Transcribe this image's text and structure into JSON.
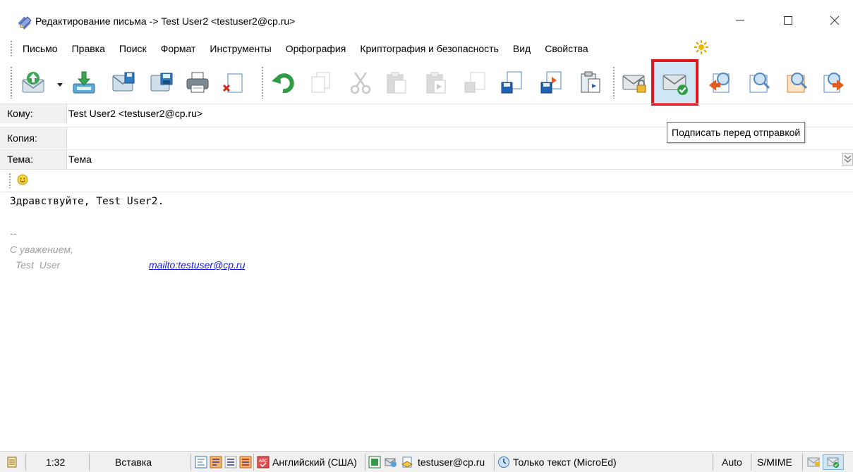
{
  "window": {
    "title": "Редактирование письма -> Test User2 <testuser2@cp.ru>",
    "icon": "edit-pencil-icon"
  },
  "menu": {
    "items": [
      {
        "label": "Письмо"
      },
      {
        "label": "Правка"
      },
      {
        "label": "Поиск"
      },
      {
        "label": "Формат"
      },
      {
        "label": "Инструменты"
      },
      {
        "label": "Орфография"
      },
      {
        "label": "Криптография и безопасность"
      },
      {
        "label": "Вид"
      },
      {
        "label": "Свойства"
      }
    ]
  },
  "toolbar": {
    "buttons": [
      "send-icon",
      "save-to-outbox-icon",
      "save-draft-icon",
      "save-template-icon",
      "print-icon",
      "discard-icon",
      "undo-icon",
      "copy-icon",
      "cut-icon",
      "paste-icon",
      "paste-special-icon",
      "save-file-icon",
      "save-disk-icon",
      "export-icon",
      "clipboard-icon",
      "encrypt-icon",
      "sign-icon",
      "find-prev-icon",
      "find-icon",
      "find-next-icon",
      "replace-icon"
    ],
    "highlighted": "sign-icon"
  },
  "fields": {
    "to_label": "Кому:",
    "to_value": "Test User2 <testuser2@cp.ru>",
    "cc_label": "Копия:",
    "cc_value": "",
    "subject_label": "Тема:",
    "subject_value": "Тема"
  },
  "tooltip": "Подписать перед отправкой",
  "body": {
    "greeting": "Здравствуйте, Test User2.",
    "sig_separator": "--",
    "sig_regards": "С уважением,",
    "sig_name": "Test  User",
    "sig_mail": "mailto:testuser@cp.ru"
  },
  "statusbar": {
    "position": "1:32",
    "mode": "Вставка",
    "language": "Английский (США)",
    "account": "testuser@cp.ru",
    "format": "Только текст (MicroEd)",
    "charset": "Auto",
    "security": "S/MIME"
  },
  "colors": {
    "highlight_border": "#e0171e",
    "highlight_fill": "#cfe6f7",
    "link": "#1a1ad9",
    "signature_gray": "#a0a0a0"
  }
}
